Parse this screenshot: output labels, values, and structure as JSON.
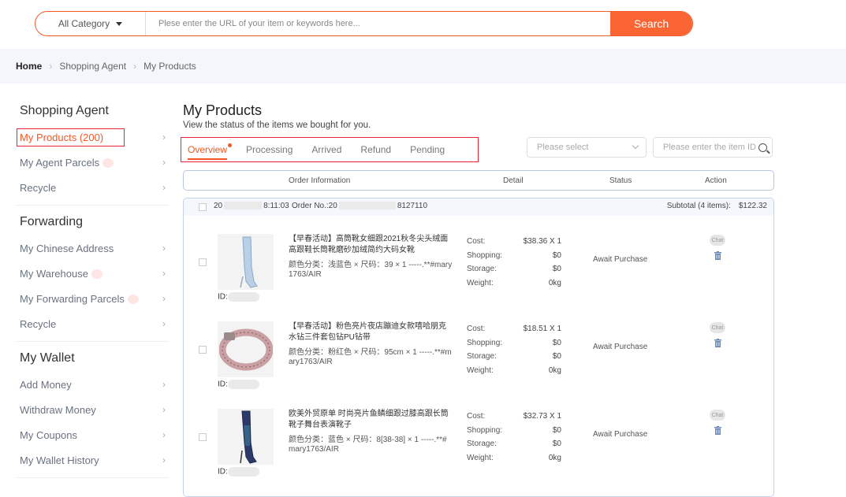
{
  "search": {
    "category": "All Category",
    "placeholder": "Plese enter the URL of your item or keywords here...",
    "button": "Search"
  },
  "breadcrumb": [
    "Home",
    "Shopping Agent",
    "My Products"
  ],
  "sidebar": {
    "groups": [
      {
        "title": "Shopping Agent",
        "items": [
          "My Products (200)",
          "My Agent Parcels",
          "Recycle"
        ]
      },
      {
        "title": "Forwarding",
        "items": [
          "My Chinese Address",
          "My Warehouse",
          "My Forwarding Parcels",
          "Recycle"
        ]
      },
      {
        "title": "My Wallet",
        "items": [
          "Add Money",
          "Withdraw Money",
          "My Coupons",
          "My Wallet History"
        ]
      }
    ]
  },
  "main": {
    "title": "My Products",
    "subtitle": "View the status of the items we bought for you.",
    "tabs": [
      "Overview",
      "Processing",
      "Arrived",
      "Refund",
      "Pending"
    ],
    "status_placeholder": "Please select",
    "id_placeholder": "Please enter the item ID",
    "columns": [
      "Order Information",
      "Detail",
      "Status",
      "Action"
    ]
  },
  "order": {
    "date_prefix": "20",
    "time": "8:11:03",
    "order_no_prefix": "Order No.:20",
    "order_no_suffix": "8127110",
    "subtotal_label": "Subtotal (4 items):",
    "subtotal_value": "$122.32",
    "detail_labels": [
      "Cost:",
      "Shopping:",
      "Storage:",
      "Weight:"
    ],
    "items": [
      {
        "name": "【早春活动】高筒靴女细跟2021秋冬尖头绒面高跟鞋长筒靴磨砂加绒简约大码女靴",
        "variant": "颜色分类：浅蓝色 × 尺码：39 × 1 -----.**#mary1763/AIR",
        "cost": "$38.36 X 1",
        "shopping": "$0",
        "storage": "$0",
        "weight": "0kg",
        "status": "Await Purchase",
        "id_prefix": "ID:"
      },
      {
        "name": "【早春活动】粉色亮片夜店蹦迪女款嘻哈朋克水钻三件套包钻PU钻带",
        "variant": "颜色分类：粉红色 × 尺码：95cm × 1 -----.**#mary1763/AIR",
        "cost": "$18.51 X 1",
        "shopping": "$0",
        "storage": "$0",
        "weight": "0kg",
        "status": "Await Purchase",
        "id_prefix": "ID:"
      },
      {
        "name": "欧美外贸原单 时尚亮片鱼鳞细跟过膝高跟长筒靴子舞台表演靴子",
        "variant": "颜色分类：蓝色 × 尺码：8[38-38] × 1 -----.**#mary1763/AIR",
        "cost": "$32.73 X 1",
        "shopping": "$0",
        "storage": "$0",
        "weight": "0kg",
        "status": "Await Purchase",
        "id_prefix": "ID:"
      }
    ],
    "chat_label": "Chat"
  },
  "colors": {
    "accent": "#fb6433",
    "active_text": "#f05a28",
    "highlight_border": "#ee2233"
  }
}
